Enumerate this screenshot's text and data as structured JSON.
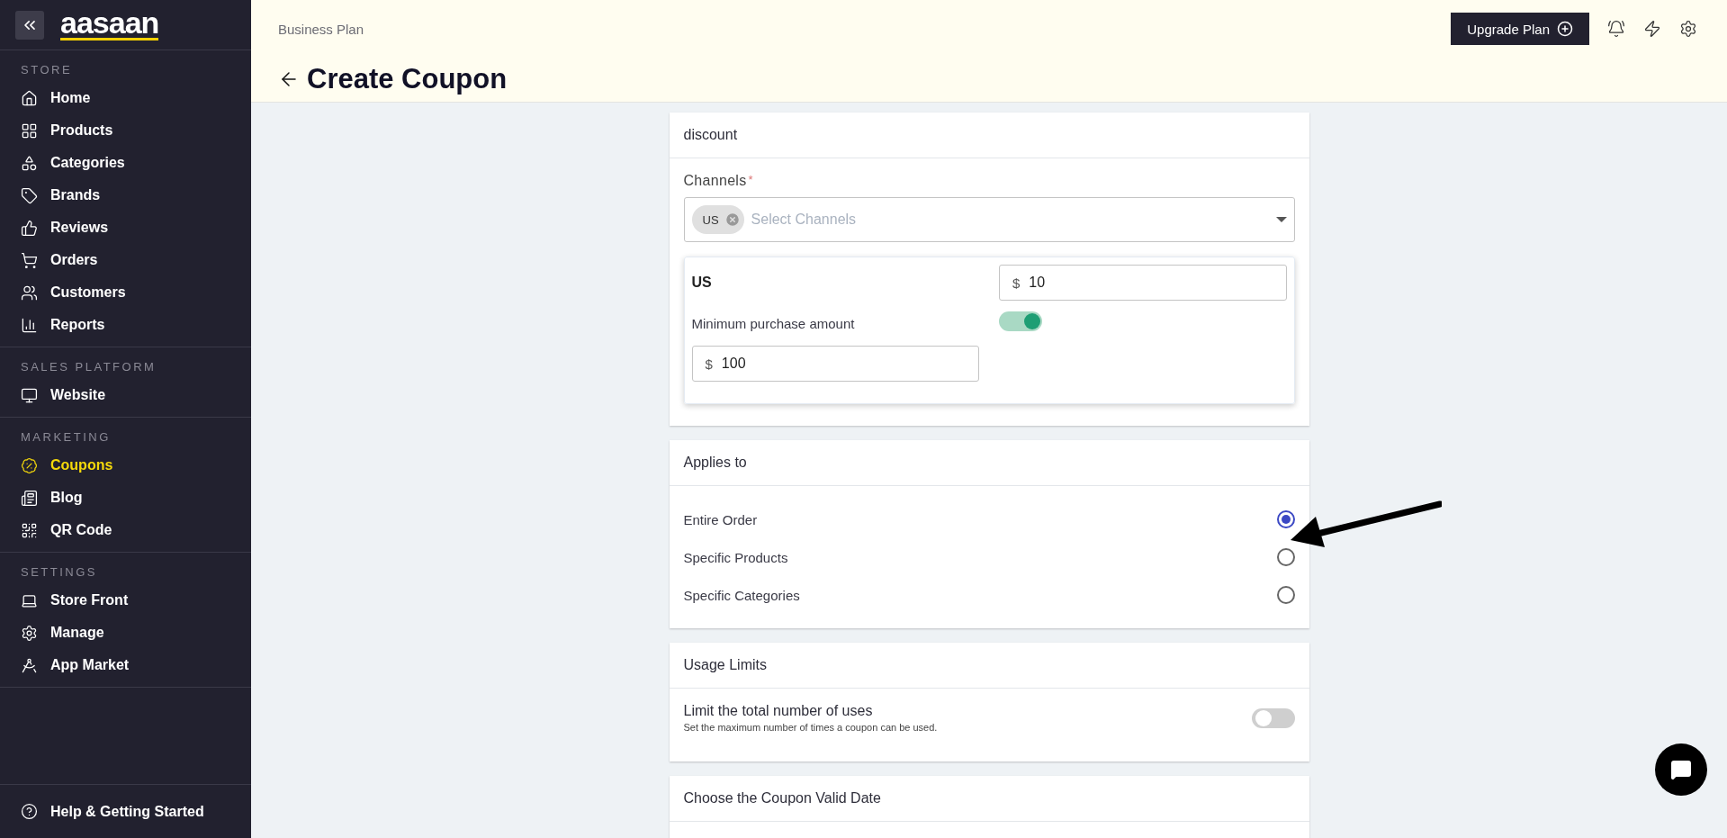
{
  "sidebar": {
    "logo": "aasaan",
    "sections": [
      {
        "title": "STORE",
        "items": [
          {
            "label": "Home",
            "selected": false
          },
          {
            "label": "Products",
            "selected": false
          },
          {
            "label": "Categories",
            "selected": false
          },
          {
            "label": "Brands",
            "selected": false
          },
          {
            "label": "Reviews",
            "selected": false
          },
          {
            "label": "Orders",
            "selected": false
          },
          {
            "label": "Customers",
            "selected": false
          },
          {
            "label": "Reports",
            "selected": false
          }
        ]
      },
      {
        "title": "SALES PLATFORM",
        "items": [
          {
            "label": "Website",
            "selected": false
          }
        ]
      },
      {
        "title": "MARKETING",
        "items": [
          {
            "label": "Coupons",
            "selected": true
          },
          {
            "label": "Blog",
            "selected": false
          },
          {
            "label": "QR Code",
            "selected": false
          }
        ]
      },
      {
        "title": "SETTINGS",
        "items": [
          {
            "label": "Store Front",
            "selected": false
          },
          {
            "label": "Manage",
            "selected": false
          },
          {
            "label": "App Market",
            "selected": false
          }
        ]
      }
    ],
    "help": "Help & Getting Started"
  },
  "header": {
    "plan": "Business Plan",
    "upgrade": "Upgrade Plan",
    "title": "Create Coupon"
  },
  "discount": {
    "title": "discount",
    "channels_label": "Channels",
    "required_mark": "*",
    "chips": [
      {
        "label": "US"
      }
    ],
    "placeholder": "Select Channels",
    "channels": [
      {
        "name": "US",
        "currency": "$",
        "amount": "10",
        "min_purchase": {
          "label": "Minimum purchase amount",
          "on": true,
          "currency": "$",
          "amount": "100"
        }
      }
    ]
  },
  "applies_to": {
    "title": "Applies to",
    "options": [
      {
        "label": "Entire Order",
        "selected": true
      },
      {
        "label": "Specific Products",
        "selected": false
      },
      {
        "label": "Specific Categories",
        "selected": false
      }
    ]
  },
  "usage_limits": {
    "title": "Usage Limits",
    "toggle": {
      "label": "Limit the total number of uses",
      "description": "Set the maximum number of times a coupon can be used.",
      "on": false
    }
  },
  "valid_date": {
    "title": "Choose the Coupon Valid Date"
  }
}
